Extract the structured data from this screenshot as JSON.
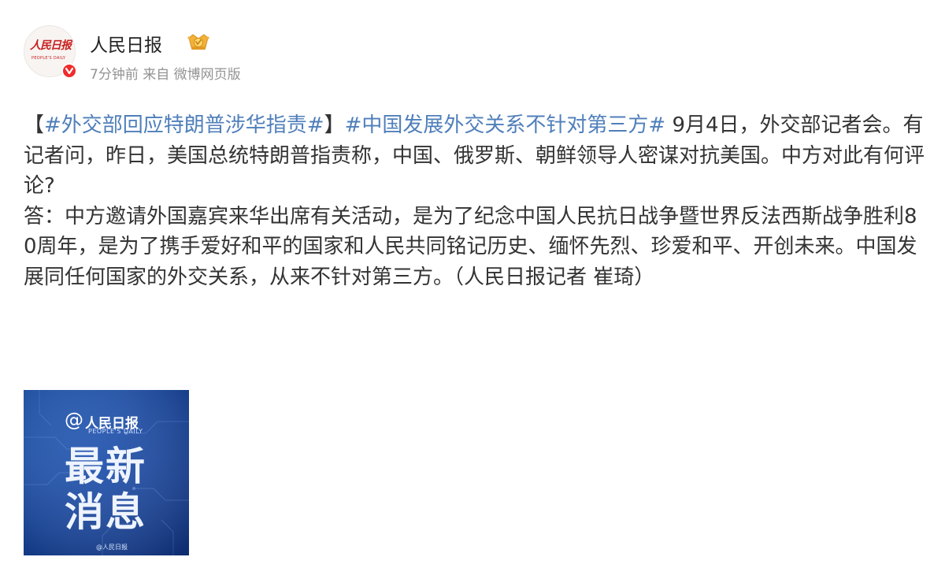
{
  "account": {
    "avatar_logo_text": "人民日报",
    "avatar_logo_sub": "PEOPLE'S DAILY",
    "name": "人民日报",
    "verified_icon": "verified-red-v-icon",
    "vip_icon": "vip-crown-icon",
    "time": "7分钟前",
    "source_prefix": "来自",
    "source": "微博网页版"
  },
  "post": {
    "bracket_open": "【",
    "topic1": "#外交部回应特朗普涉华指责#",
    "bracket_close": "】",
    "topic2": "#中国发展外交关系不针对第三方#",
    "body1": " 9月4日，外交部记者会。有记者问，昨日，美国总统特朗普指责称，中国、俄罗斯、朝鲜领导人密谋对抗美国。中方对此有何评论?",
    "body2": "答：中方邀请外国嘉宾来华出席有关活动，是为了纪念中国人民抗日战争暨世界反法西斯战争胜利80周年，是为了携手爱好和平的国家和人民共同铭记历史、缅怀先烈、珍爱和平、开创未来。中国发展同任何国家的外交关系，从来不针对第三方。（人民日报记者 崔琦）"
  },
  "image": {
    "at": "@",
    "brand": "人民日报",
    "brand_sub": "PEOPLE'S DAILY",
    "headline": "最新消息",
    "footer": "@人民日报",
    "colors": {
      "bg_top": "#2a66c8",
      "bg_bottom": "#13388a"
    }
  },
  "colors": {
    "topic": "#4f7fba",
    "text": "#333333",
    "meta": "#939393",
    "verified": "#f12b2b",
    "logo_red": "#c8201f"
  }
}
